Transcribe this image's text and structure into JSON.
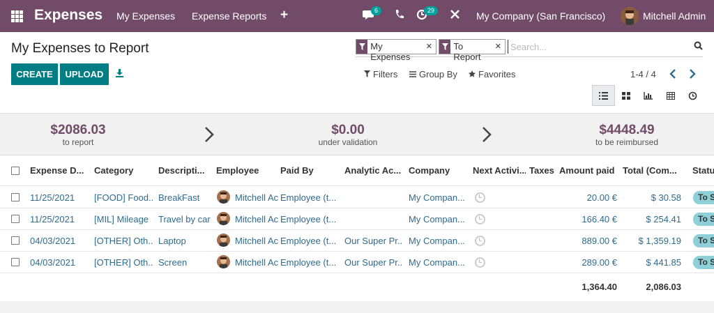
{
  "nav": {
    "app_title": "Expenses",
    "menu": [
      "My Expenses",
      "Expense Reports"
    ],
    "messages_count": "6",
    "activities_count": "29",
    "company": "My Company (San Francisco)",
    "user": "Mitchell Admin"
  },
  "page": {
    "title": "My Expenses to Report",
    "create_label": "CREATE",
    "upload_label": "UPLOAD"
  },
  "search": {
    "facets": [
      "My Expenses",
      "To Report"
    ],
    "placeholder": "Search...",
    "filters_label": "Filters",
    "groupby_label": "Group By",
    "favorites_label": "Favorites",
    "pager": "1-4 / 4"
  },
  "summary": [
    {
      "amount": "$2086.03",
      "label": "to report"
    },
    {
      "amount": "$0.00",
      "label": "under validation"
    },
    {
      "amount": "$4448.49",
      "label": "to be reimbursed"
    }
  ],
  "table": {
    "headers": [
      "Expense D...",
      "Category",
      "Descripti...",
      "Employee",
      "Paid By",
      "Analytic Ac...",
      "Company",
      "Next Activi...",
      "Taxes",
      "Amount paid",
      "Total (Com...",
      "Status"
    ],
    "rows": [
      {
        "date": "11/25/2021",
        "category": "[FOOD] Food...",
        "description": "BreakFast",
        "employee": "Mitchell Ac",
        "paid_by": "Employee (t...",
        "analytic": "",
        "company": "My Compan...",
        "amount": "20.00 €",
        "total": "$ 30.58",
        "status": "To S"
      },
      {
        "date": "11/25/2021",
        "category": "[MIL] Mileage",
        "description": "Travel by car",
        "employee": "Mitchell Ac",
        "paid_by": "Employee (t...",
        "analytic": "",
        "company": "My Compan...",
        "amount": "166.40 €",
        "total": "$ 254.41",
        "status": "To S"
      },
      {
        "date": "04/03/2021",
        "category": "[OTHER] Oth...",
        "description": "Laptop",
        "employee": "Mitchell Ac",
        "paid_by": "Employee (t...",
        "analytic": "Our Super Pr...",
        "company": "My Compan...",
        "amount": "889.00 €",
        "total": "$ 1,359.19",
        "status": "To S"
      },
      {
        "date": "04/03/2021",
        "category": "[OTHER] Oth...",
        "description": "Screen",
        "employee": "Mitchell Ac",
        "paid_by": "Employee (t...",
        "analytic": "Our Super Pr...",
        "company": "My Compan...",
        "amount": "289.00 €",
        "total": "$ 441.85",
        "status": "To S"
      }
    ],
    "total_amount": "1,364.40",
    "total_company": "2,086.03"
  },
  "colors": {
    "brand": "#714b67",
    "button": "#017e84",
    "link": "#2e6b8f",
    "status": "#8fd0d8"
  }
}
